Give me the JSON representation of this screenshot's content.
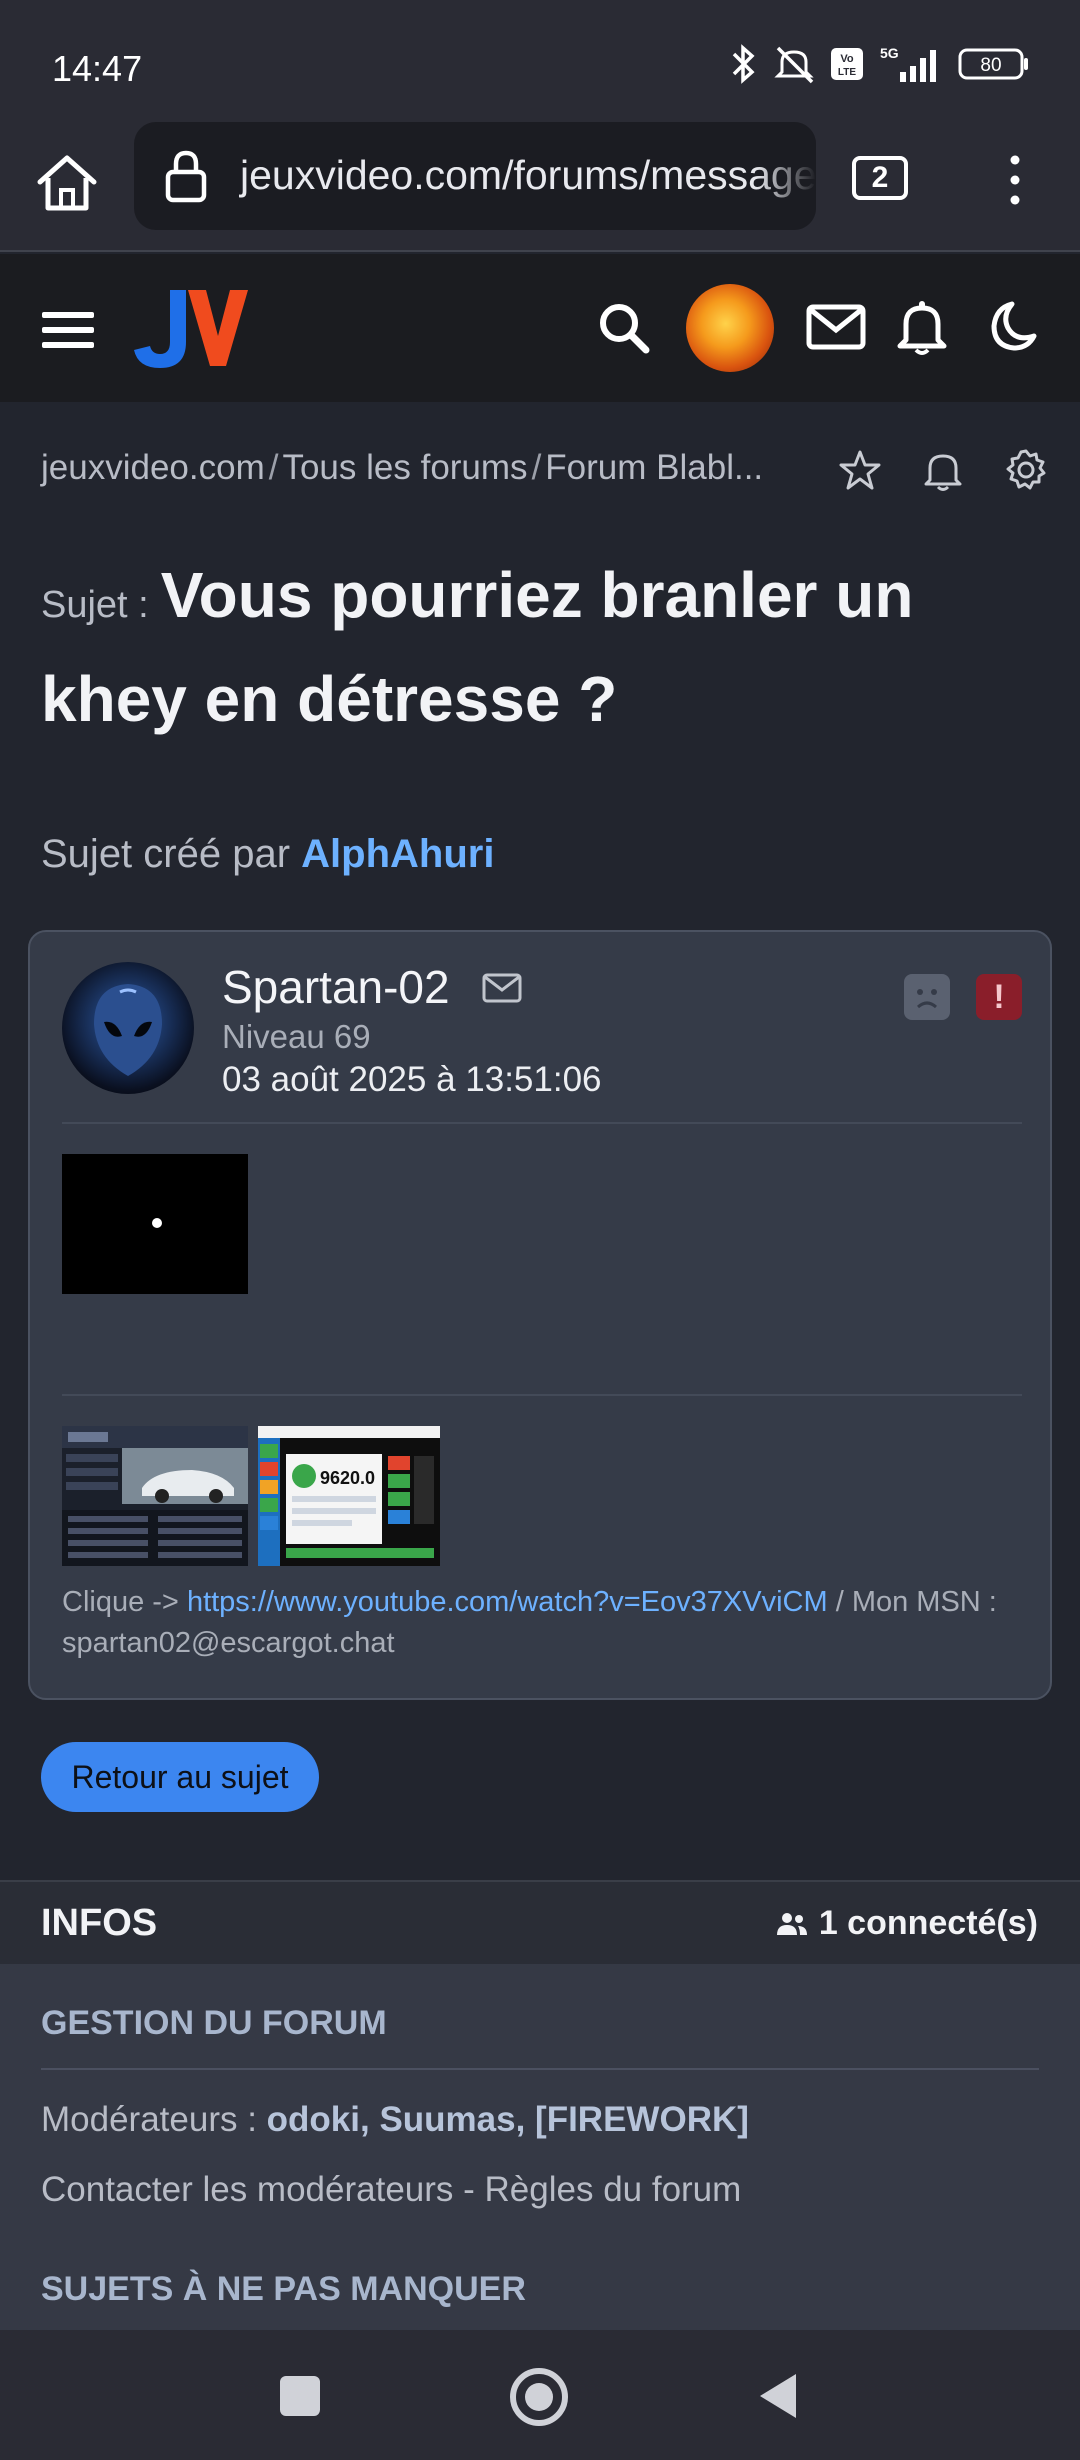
{
  "status_bar": {
    "time": "14:47",
    "battery": "80",
    "network": "5G"
  },
  "browser": {
    "url": "jeuxvideo.com/forums/message/",
    "tab_count": "2"
  },
  "breadcrumb": {
    "items": [
      "jeuxvideo.com",
      "Tous les forums",
      "Forum Blabl..."
    ]
  },
  "topic": {
    "prefix": "Sujet :",
    "title": "Vous pourriez branler un khey en détresse ?",
    "created_by_label": "Sujet créé par",
    "created_by": "AlphAhuri"
  },
  "post": {
    "author": "Spartan-02",
    "level": "Niveau 69",
    "date": "03 août 2025 à 13:51:06",
    "report_label": "!",
    "signature_prefix": "Clique ->",
    "signature_link": "https://www.youtube.com/watch?v=Eov37XVviCM",
    "signature_suffix": " / Mon MSN : spartan02@escargot.chat",
    "thumb2_text": "9620.0"
  },
  "back_button": "Retour au sujet",
  "infos": {
    "title": "INFOS",
    "connected": "1 connecté(s)",
    "gestion": "GESTION DU FORUM",
    "moderators_label": "Modérateurs :",
    "moderators": "odoki, Suumas, [FIREWORK]",
    "contact": "Contacter les modérateurs - Règles du forum",
    "sujets": "SUJETS À NE PAS MANQUER"
  },
  "colors": {
    "accent": "#3c86f0",
    "link": "#6db1ff",
    "background": "#22252e",
    "card": "#353b48"
  }
}
